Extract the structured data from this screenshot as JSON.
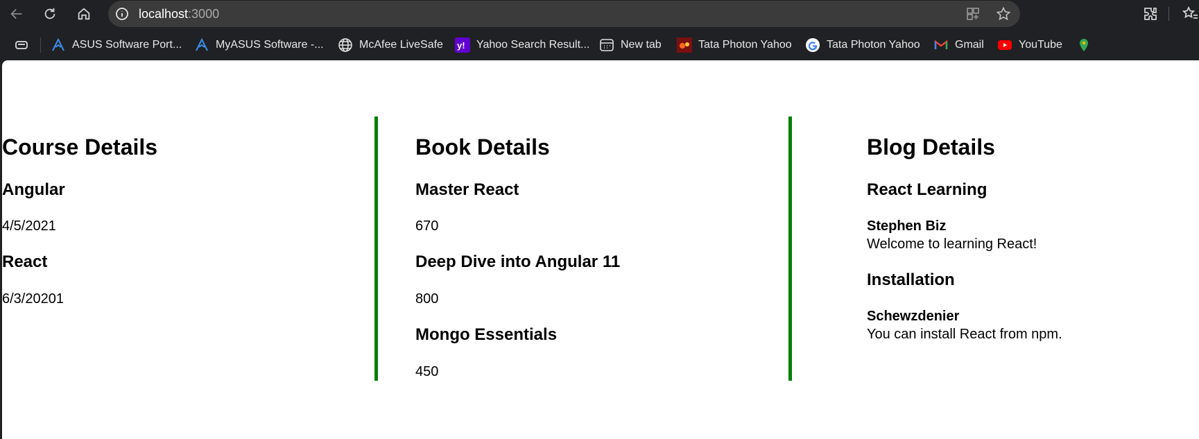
{
  "browser": {
    "url_host": "localhost",
    "url_port": ":3000"
  },
  "bookmarks": [
    {
      "label": "ASUS Software Port...",
      "icon": "asus-icon"
    },
    {
      "label": "MyASUS Software -...",
      "icon": "asus-icon"
    },
    {
      "label": "McAfee LiveSafe",
      "icon": "globe-icon"
    },
    {
      "label": "Yahoo Search Result...",
      "icon": "yahoo-icon"
    },
    {
      "label": "New tab",
      "icon": "new-tab-icon"
    },
    {
      "label": "Tata Photon Yahoo",
      "icon": "tata-icon"
    },
    {
      "label": "Tata Photon Yahoo",
      "icon": "google-icon"
    },
    {
      "label": "Gmail",
      "icon": "gmail-icon"
    },
    {
      "label": "YouTube",
      "icon": "youtube-icon"
    }
  ],
  "course": {
    "heading": "Course Details",
    "items": [
      {
        "name": "Angular",
        "date": "4/5/2021"
      },
      {
        "name": "React",
        "date": "6/3/20201"
      }
    ]
  },
  "book": {
    "heading": "Book Details",
    "items": [
      {
        "name": "Master React",
        "price": "670"
      },
      {
        "name": "Deep Dive into Angular 11",
        "price": "800"
      },
      {
        "name": "Mongo Essentials",
        "price": "450"
      }
    ]
  },
  "blog": {
    "heading": "Blog Details",
    "items": [
      {
        "title": "React Learning",
        "author": "Stephen Biz",
        "content": "Welcome to learning React!"
      },
      {
        "title": "Installation",
        "author": "Schewzdenier",
        "content": "You can install React from npm."
      }
    ]
  },
  "colors": {
    "divider": "#008000",
    "chrome_bg": "#202124",
    "omnibox_bg": "#3b3b3b"
  }
}
